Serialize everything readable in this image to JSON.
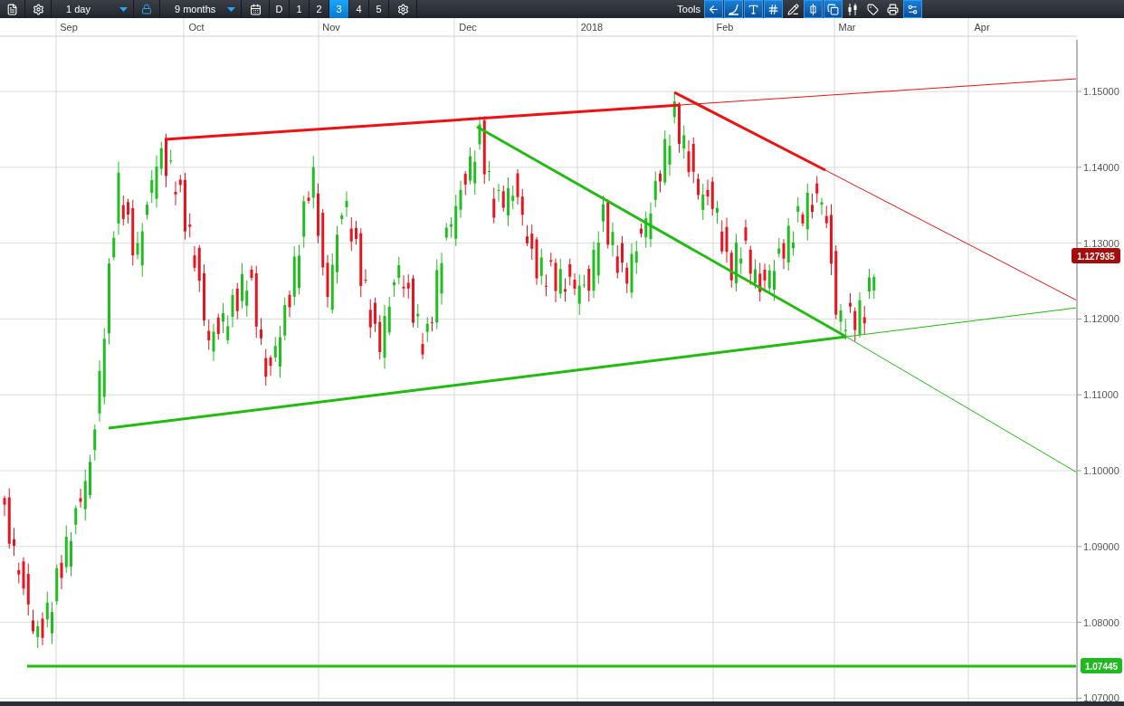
{
  "toolbar": {
    "interval": "1 day",
    "range": "9 months",
    "presets": [
      {
        "label": "D",
        "selected": false
      },
      {
        "label": "1",
        "selected": false
      },
      {
        "label": "2",
        "selected": false
      },
      {
        "label": "3",
        "selected": true
      },
      {
        "label": "4",
        "selected": false
      },
      {
        "label": "5",
        "selected": false
      }
    ],
    "tools_label": "Tools",
    "tools": [
      {
        "active": true
      },
      {
        "active": true
      },
      {
        "active": true
      },
      {
        "active": true
      },
      {
        "active": false
      },
      {
        "active": true
      },
      {
        "active": true
      },
      {
        "active": false
      },
      {
        "active": false
      },
      {
        "active": false
      },
      {
        "active": true
      }
    ]
  },
  "chart": {
    "x_labels": [
      "Sep",
      "Oct",
      "Nov",
      "Dec",
      "2018",
      "Feb",
      "Mar",
      "Apr"
    ],
    "y_labels": [
      "1.15000",
      "1.14000",
      "1.13000",
      "1.12000",
      "1.11000",
      "1.10000",
      "1.09000",
      "1.08000",
      "1.07000"
    ],
    "last_price": "1.127935",
    "support_price": "1.07445"
  }
}
